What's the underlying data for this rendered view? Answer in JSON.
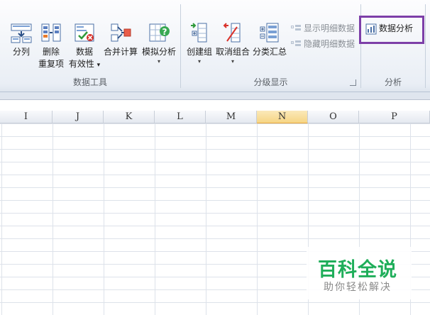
{
  "ribbon": {
    "data_tools": {
      "group_label": "数据工具",
      "split_label": "分列",
      "remove_dup_line1": "删除",
      "remove_dup_line2": "重复项",
      "validation_line1": "数据",
      "validation_line2": "有效性",
      "consolidate_label": "合并计算",
      "whatif_label": "模拟分析"
    },
    "outline": {
      "group_label": "分级显示",
      "group_btn": "创建组",
      "ungroup_btn": "取消组合",
      "subtotal_btn": "分类汇总",
      "show_detail": "显示明细数据",
      "hide_detail": "隐藏明细数据"
    },
    "analysis": {
      "group_label": "分析",
      "data_analysis": "数据分析"
    },
    "dropdown_glyph": "▾"
  },
  "sheet": {
    "columns": [
      "I",
      "J",
      "K",
      "L",
      "M",
      "N",
      "O",
      "P"
    ],
    "selected_column": "N"
  },
  "watermark": {
    "title": "百科全说",
    "subtitle": "助你轻松解决"
  },
  "colors": {
    "highlight_box": "#7d3fa8",
    "watermark_green": "#1fae5a",
    "selected_header": "#f6d584"
  }
}
